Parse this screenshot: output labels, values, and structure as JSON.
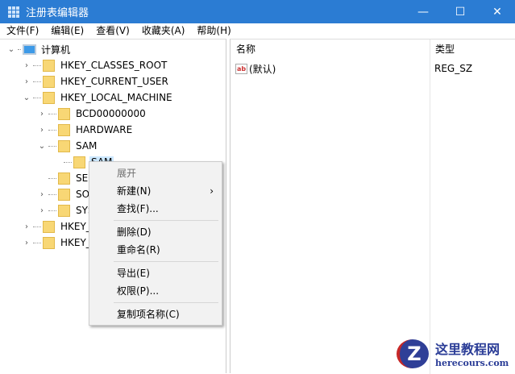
{
  "window": {
    "title": "注册表编辑器",
    "minimize": "—",
    "maximize": "☐",
    "close": "✕"
  },
  "menubar": [
    "文件(F)",
    "编辑(E)",
    "查看(V)",
    "收藏夹(A)",
    "帮助(H)"
  ],
  "tree": {
    "root": "计算机",
    "items": [
      {
        "label": "HKEY_CLASSES_ROOT",
        "level": 1,
        "toggle": "›"
      },
      {
        "label": "HKEY_CURRENT_USER",
        "level": 1,
        "toggle": "›"
      },
      {
        "label": "HKEY_LOCAL_MACHINE",
        "level": 1,
        "toggle": "⌄"
      },
      {
        "label": "BCD00000000",
        "level": 2,
        "toggle": "›"
      },
      {
        "label": "HARDWARE",
        "level": 2,
        "toggle": "›"
      },
      {
        "label": "SAM",
        "level": 2,
        "toggle": "⌄"
      },
      {
        "label": "SAM",
        "level": 3,
        "toggle": "",
        "selected": true
      },
      {
        "label": "SECURITY",
        "level": 2,
        "toggle": ""
      },
      {
        "label": "SOFTWARE",
        "level": 2,
        "toggle": "›"
      },
      {
        "label": "SYSTEM",
        "level": 2,
        "toggle": "›"
      },
      {
        "label": "HKEY_USERS",
        "level": 1,
        "toggle": "›"
      },
      {
        "label": "HKEY_CURRENT_CONFIG",
        "level": 1,
        "toggle": "›"
      }
    ]
  },
  "list": {
    "col_name": "名称",
    "col_type": "类型",
    "rows": [
      {
        "name": "(默认)",
        "type": "REG_SZ",
        "icon": "ab"
      }
    ]
  },
  "context_menu": {
    "expand": "展开",
    "new": "新建(N)",
    "new_arrow": "›",
    "find": "查找(F)...",
    "delete": "删除(D)",
    "rename": "重命名(R)",
    "export": "导出(E)",
    "permissions": "权限(P)...",
    "copy_key_name": "复制项名称(C)"
  },
  "watermark": {
    "logo": "Z",
    "name": "这里教程网",
    "url": "herecours.com"
  }
}
